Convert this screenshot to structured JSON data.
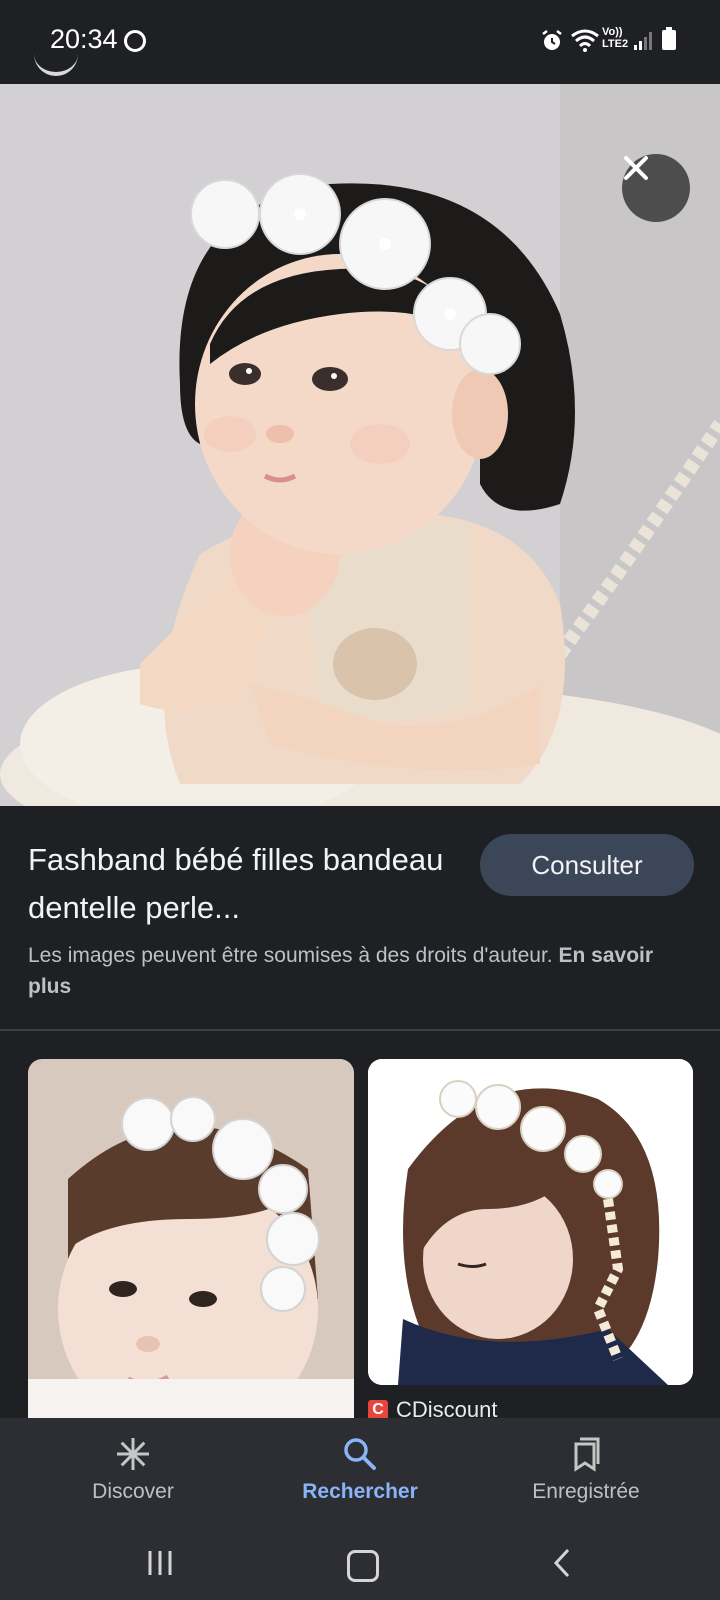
{
  "status_bar": {
    "time": "20:34",
    "network_label_top": "Vo))",
    "network_label_bottom": "LTE2",
    "icons": [
      "sync-ring-icon",
      "alarm-icon",
      "wifi-icon",
      "signal-icon",
      "battery-icon"
    ]
  },
  "viewer": {
    "close_icon": "close-icon",
    "lens_icon": "google-lens-icon",
    "title": "Fashband bébé filles bandeau dentelle perle...",
    "visit_label": "Consulter",
    "copyright_text": "Les images peuvent être soumises à des droits d'auteur.",
    "copyright_link": "En savoir plus"
  },
  "related": [
    {
      "source": ""
    },
    {
      "source": "CDiscount",
      "source_logo_letter": "C",
      "source_logo_color": "#e8453c"
    }
  ],
  "bottom_nav": [
    {
      "label": "Discover",
      "icon": "asterisk-icon",
      "active": false
    },
    {
      "label": "Rechercher",
      "icon": "search-icon",
      "active": true
    },
    {
      "label": "Enregistrée",
      "icon": "bookmarks-icon",
      "active": false
    }
  ],
  "colors": {
    "background": "#1f2024",
    "visit_button": "#3b4658",
    "active_nav": "#8ab4f8",
    "nav_background": "#2c2e33"
  }
}
